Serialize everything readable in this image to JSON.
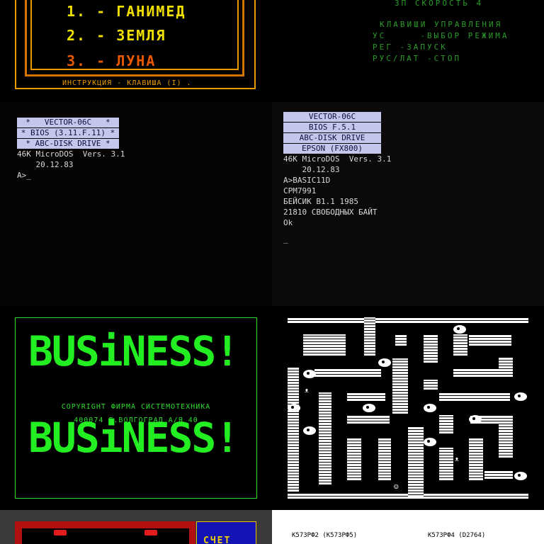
{
  "game_menu": {
    "items": [
      {
        "label": "1. - ГАНИМЕД",
        "color": "#f0e000"
      },
      {
        "label": "2. - ЗЕМЛЯ",
        "color": "#f0e000"
      },
      {
        "label": "3. - ЛУНА",
        "color": "#e85800"
      }
    ],
    "hint": "ИНСТРУКЦИЯ - КЛАВИША (I) ."
  },
  "controls": {
    "speed": "ЗП СКОРОСТЬ 4",
    "title": "КЛАВИШИ УПРАВЛЕНИЯ",
    "lines": [
      "УС     -ВЫБОР РЕЖИМА",
      "РЕГ -ЗАПУСК",
      "РУС/ЛАТ -СТОП"
    ]
  },
  "dos1": {
    "bars": [
      "*   VECTOR-06C   *",
      "* BIOS (3.11.F.11) *",
      "* ABC-DISK DRIVE *"
    ],
    "lines": [
      "46K MicroDOS  Vers. 3.1",
      "    20.12.83",
      "A>_"
    ]
  },
  "dos2": {
    "bars": [
      "VECTOR-06C",
      "BIOS F.5.1",
      "ABC-DISK DRIVE",
      "EPSON (FX800)"
    ],
    "lines": [
      "46K MicroDOS  Vers. 3.1",
      "    20.12.83",
      "A>BASIC11D",
      "CPM7991",
      "БЕЙСИК В1.1 1985",
      "21810 СВОБОДНЫХ БАЙТ",
      "Ok",
      "",
      "_"
    ]
  },
  "business": {
    "title1": "BUSiNESS!",
    "copyright": "COPYRIGHT ФИРМА СИСТЕМОТЕХНИКА",
    "address": "400074 Г.ВОЛГОГРАД А/Я 40",
    "title2": "BUSiNESS!",
    "accent": "#22ee22"
  },
  "game2": {
    "score_label": "СЧЕТ"
  },
  "chips": {
    "left": "K573РФ2 (K573РФ5)",
    "right": "K573РФ4 (D2764)"
  }
}
